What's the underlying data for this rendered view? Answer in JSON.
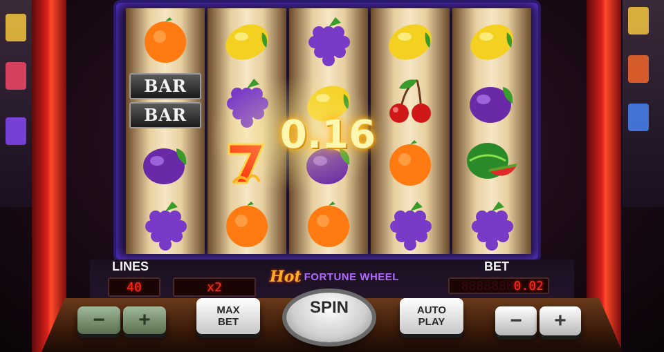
{
  "win": {
    "amount": "0.16"
  },
  "reels": [
    [
      "orange",
      "bar-double",
      "plum",
      "grapes"
    ],
    [
      "lemon",
      "grapes",
      "seven",
      "orange"
    ],
    [
      "grapes",
      "lemon",
      "plum",
      "orange"
    ],
    [
      "lemon",
      "cherries",
      "orange",
      "grapes"
    ],
    [
      "lemon",
      "plum",
      "watermelon",
      "grapes"
    ]
  ],
  "bar_text": "BAR",
  "seven_text": "7",
  "panel": {
    "lines_label": "LINES",
    "lines_value": "40",
    "multiplier": "x2",
    "bet_label": "BET",
    "bet_dim": "8888888",
    "bet_value": "0.02"
  },
  "logo": {
    "hot": "Hot",
    "name": "FORTUNE WHEEL"
  },
  "buttons": {
    "lines_minus": "−",
    "lines_plus": "+",
    "max_bet": "MAX\nBET",
    "spin": "SPIN",
    "auto_play": "AUTO\nPLAY",
    "bet_minus": "−",
    "bet_plus": "+"
  },
  "colors": {
    "orange": "#ff7a10",
    "lemon": "#f4d020",
    "grapes": "#7a3ac8",
    "plum": "#6a2aa8",
    "cherry": "#d01818",
    "leaf": "#3a9a2a",
    "led": "#ff2a1a",
    "frame": "#2a1a6a"
  }
}
